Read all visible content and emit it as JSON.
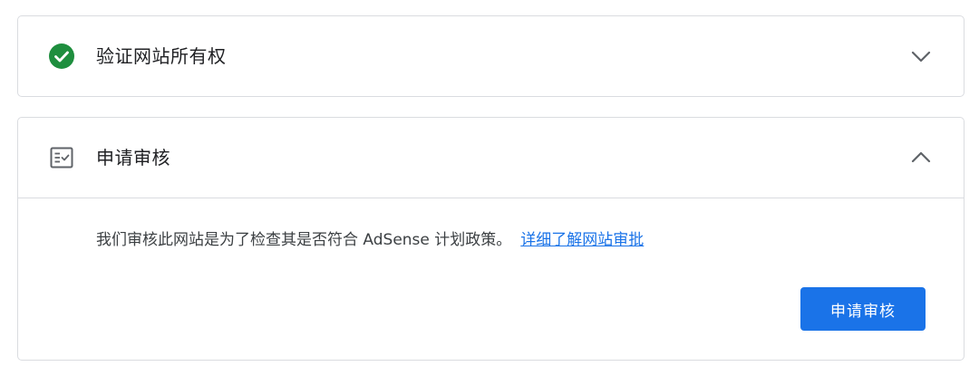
{
  "sections": [
    {
      "title": "验证网站所有权",
      "icon": "check-circle-icon",
      "status_color": "#1e8e3e",
      "expanded": false,
      "chevron": "chevron-down-icon"
    },
    {
      "title": "申请审核",
      "icon": "checklist-icon",
      "expanded": true,
      "chevron": "chevron-up-icon",
      "description": "我们审核此网站是为了检查其是否符合 AdSense 计划政策。",
      "link_label": "详细了解网站审批",
      "button_label": "申请审核",
      "accent_color": "#1a73e8"
    }
  ]
}
